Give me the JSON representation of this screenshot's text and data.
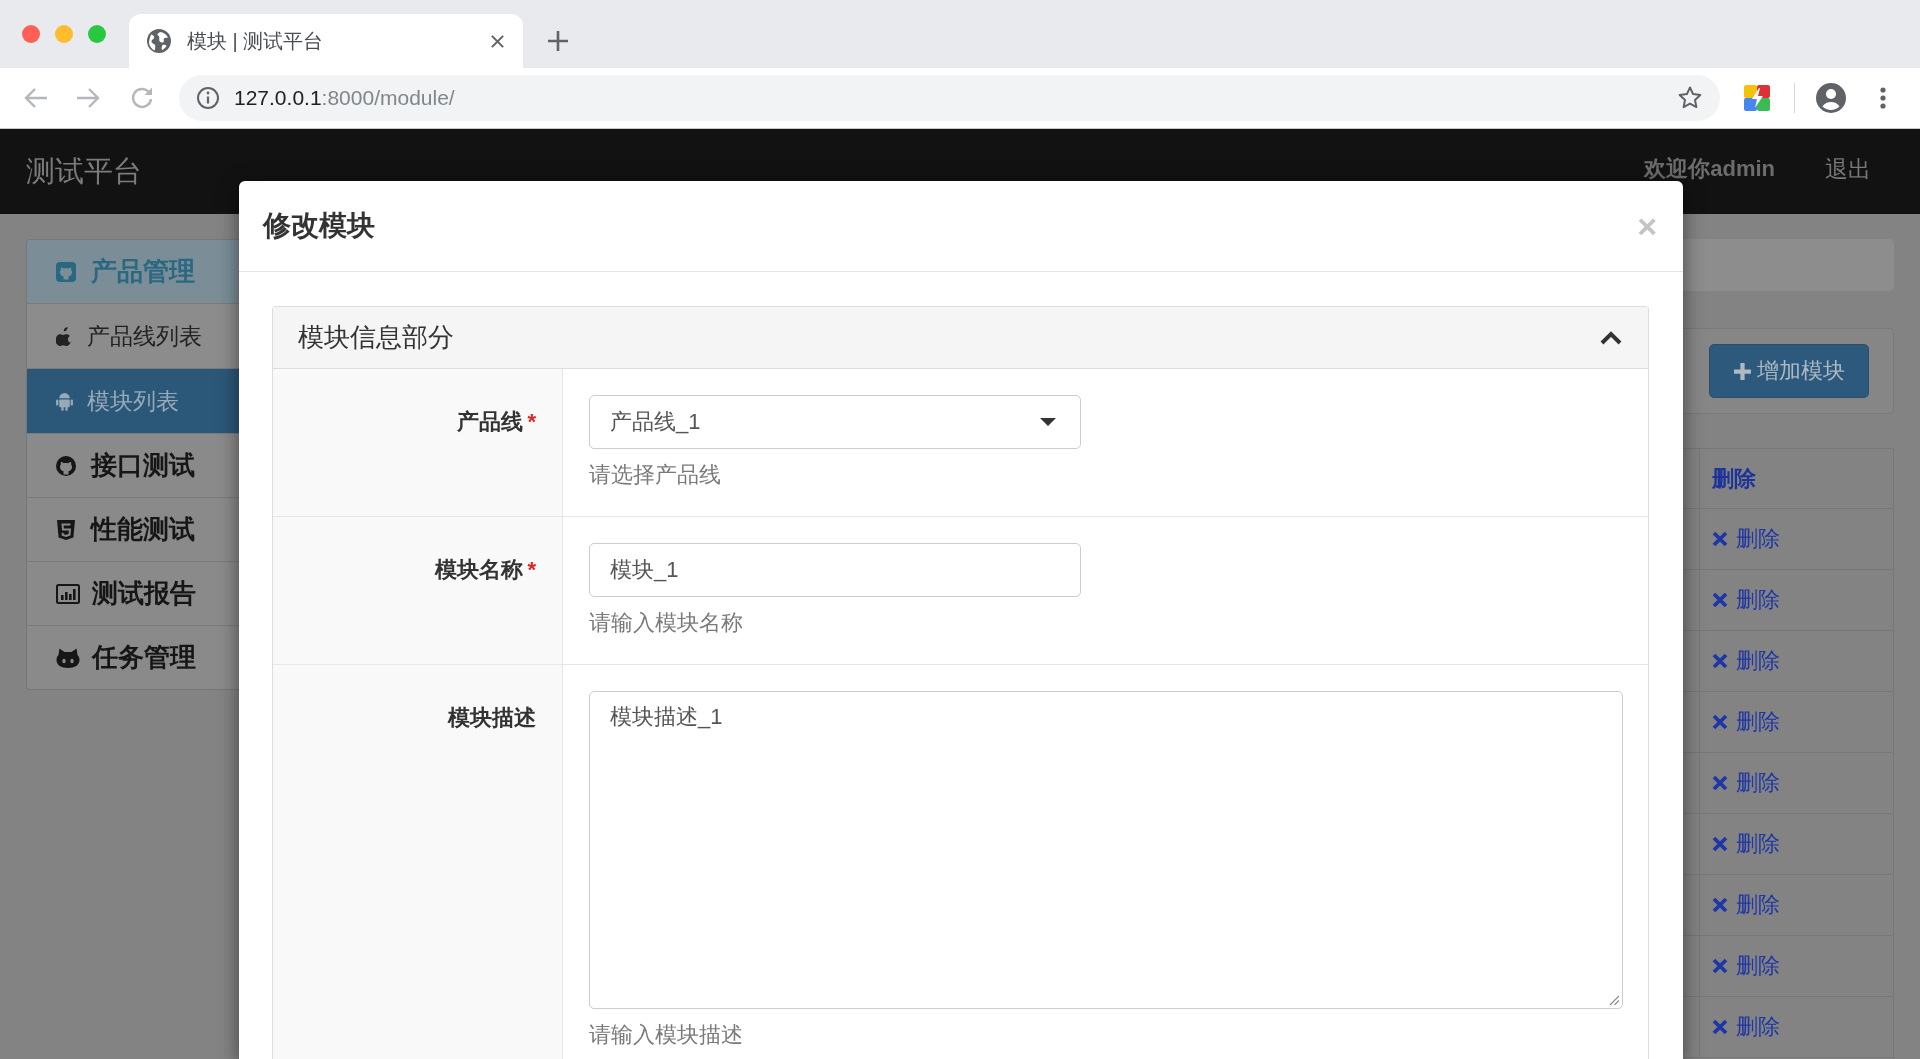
{
  "browser": {
    "tabs": [
      {
        "title": "模块 | 测试平台",
        "selected": true
      }
    ],
    "address": {
      "host": "127.0.0.1",
      "path": ":8000/module/"
    }
  },
  "navbar": {
    "brand": "测试平台",
    "welcome": "欢迎你admin",
    "logout": "退出"
  },
  "sidebar": {
    "items": [
      {
        "label": "产品管理",
        "expanded": true,
        "children": [
          {
            "label": "产品线列表",
            "selected": false
          },
          {
            "label": "模块列表",
            "selected": true
          }
        ]
      },
      {
        "label": "接口测试",
        "expanded": false
      },
      {
        "label": "性能测试",
        "expanded": false
      },
      {
        "label": "测试报告",
        "expanded": false
      },
      {
        "label": "任务管理",
        "expanded": false
      }
    ]
  },
  "toolbar": {
    "add_button": "增加模块"
  },
  "table": {
    "header": "删除",
    "rows": [
      {
        "action": "删除"
      },
      {
        "action": "删除"
      },
      {
        "action": "删除"
      },
      {
        "action": "删除"
      },
      {
        "action": "删除"
      },
      {
        "action": "删除"
      },
      {
        "action": "删除"
      },
      {
        "action": "删除"
      },
      {
        "action": "删除"
      }
    ]
  },
  "modal": {
    "title": "修改模块",
    "close": "×",
    "section": {
      "title": "模块信息部分",
      "expanded": true,
      "fields": [
        {
          "kind": "select",
          "label": "产品线",
          "required_mark": "*",
          "value": "产品线_1",
          "help": "请选择产品线"
        },
        {
          "kind": "input",
          "label": "模块名称",
          "required_mark": "*",
          "value": "模块_1",
          "help": "请输入模块名称"
        },
        {
          "kind": "textarea",
          "label": "模块描述",
          "value": "模块描述_1",
          "help": "请输入模块描述"
        }
      ]
    }
  }
}
